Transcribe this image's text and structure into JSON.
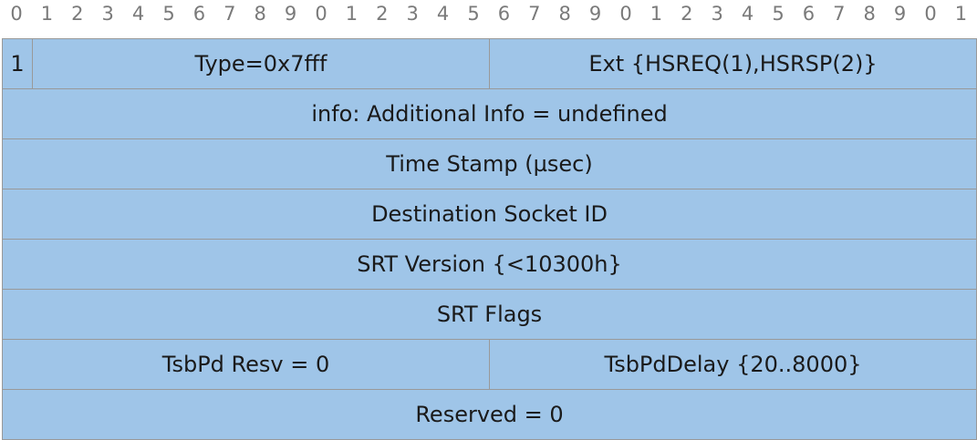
{
  "bit_ruler": [
    "0",
    "1",
    "2",
    "3",
    "4",
    "5",
    "6",
    "7",
    "8",
    "9",
    "0",
    "1",
    "2",
    "3",
    "4",
    "5",
    "6",
    "7",
    "8",
    "9",
    "0",
    "1",
    "2",
    "3",
    "4",
    "5",
    "6",
    "7",
    "8",
    "9",
    "0",
    "1"
  ],
  "rows": [
    {
      "fields": [
        "1",
        "Type=0x7fff",
        "Ext {HSREQ(1),HSRSP(2)}"
      ]
    },
    {
      "fields": [
        "info: Additional Info = undefined"
      ]
    },
    {
      "fields": [
        "Time Stamp (µsec)"
      ]
    },
    {
      "fields": [
        "Destination Socket ID"
      ]
    },
    {
      "fields": [
        "SRT Version {<10300h}"
      ]
    },
    {
      "fields": [
        "SRT Flags"
      ]
    },
    {
      "fields": [
        "TsbPd Resv = 0",
        "TsbPdDelay {20..8000}"
      ]
    },
    {
      "fields": [
        "Reserved = 0"
      ]
    }
  ],
  "colors": {
    "field_fill": "#9fc5e8",
    "border": "#999999",
    "ruler_text": "#7a7a7a"
  }
}
